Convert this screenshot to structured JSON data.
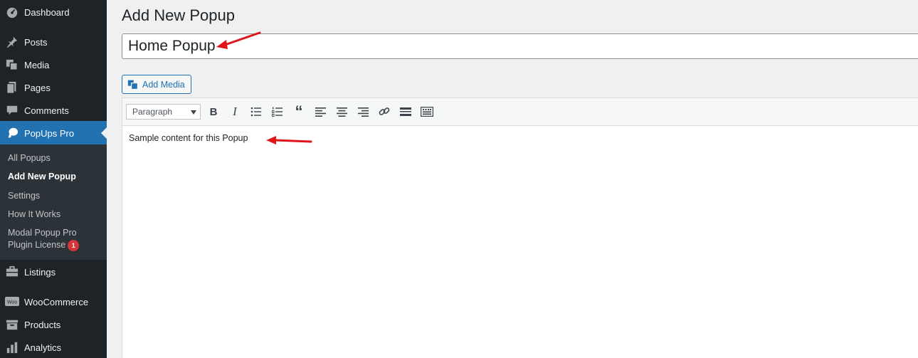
{
  "sidebar": {
    "items": [
      {
        "label": "Dashboard",
        "icon": "dashboard-icon"
      },
      {
        "label": "Posts",
        "icon": "pin-icon"
      },
      {
        "label": "Media",
        "icon": "media-icon"
      },
      {
        "label": "Pages",
        "icon": "pages-icon"
      },
      {
        "label": "Comments",
        "icon": "comment-icon"
      },
      {
        "label": "PopUps Pro",
        "icon": "megaphone-icon"
      },
      {
        "label": "Listings",
        "icon": "briefcase-icon"
      },
      {
        "label": "WooCommerce",
        "icon": "woocommerce-icon"
      },
      {
        "label": "Products",
        "icon": "archive-icon"
      },
      {
        "label": "Analytics",
        "icon": "chart-bar-icon"
      }
    ],
    "submenu": [
      {
        "label": "All Popups"
      },
      {
        "label": "Add New Popup"
      },
      {
        "label": "Settings"
      },
      {
        "label": "How It Works"
      },
      {
        "label": "Modal Popup Pro"
      },
      {
        "label": "Plugin License",
        "badge": "1"
      }
    ]
  },
  "main": {
    "page_title": "Add New Popup",
    "title_value": "Home Popup",
    "add_media_label": "Add Media",
    "editor": {
      "format_value": "Paragraph",
      "content": "Sample content for this Popup",
      "toolbar_icons": [
        "bold-icon",
        "italic-icon",
        "bulleted-list-icon",
        "numbered-list-icon",
        "blockquote-icon",
        "align-left-icon",
        "align-center-icon",
        "align-right-icon",
        "link-icon",
        "read-more-icon",
        "toolbar-toggle-icon"
      ]
    }
  },
  "annotation_color": "#e0161a"
}
